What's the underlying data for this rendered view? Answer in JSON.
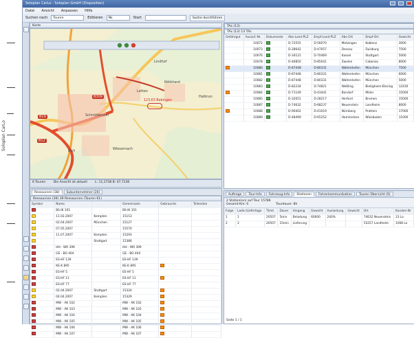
{
  "app": {
    "title": "Soloplan CarLo - Soloplan GmbH (Disposition)",
    "menu": [
      "Datei",
      "Ansicht",
      "Anpassen",
      "Hilfe"
    ],
    "window_buttons": [
      "_",
      "□",
      "✕"
    ]
  },
  "margin": {
    "vertical_text": "Soloplan CarLo"
  },
  "toolbar": {
    "search_label": "Suchen nach",
    "search_value": "Touren",
    "edit_label": "Editieren",
    "edit_value": "Nk",
    "start_label": "Start",
    "search_all_label": "Suche durchführen"
  },
  "map": {
    "panel_title": "Karte",
    "labels": [
      "Lindhof",
      "Letten",
      "Rötbhard",
      "Halbrun",
      "Schmittbrunn",
      "Eich",
      "Wiesernach"
    ],
    "roads": [
      "B19",
      "B309",
      "B12"
    ],
    "red_label": "123,63 Bebingen",
    "status_tours": "6 Touren",
    "status_text": "Die Ansicht ist aktuell",
    "status_coord": "L: 11,1738  B: 47,7136"
  },
  "tour_list": {
    "tab1": "Ressourcen (38)",
    "tab2": "Subunternehmer (20)",
    "subtitle": "Ressourcen (39)  39 Ressourcen (Touren 61)",
    "columns": [
      "Symbol",
      "Name",
      "Gemeinsam",
      "Gebrauchs",
      "Teilenden"
    ],
    "rows": [
      {
        "symbol": "truck",
        "name": "BS-IK 101",
        "place": "",
        "id": "BS-IK 101",
        "flag": false
      },
      {
        "symbol": "",
        "name": "11.02.2007",
        "place": "Kempten",
        "id": "15153",
        "flag": false
      },
      {
        "symbol": "",
        "name": "02.04.2007",
        "place": "München",
        "id": "15127",
        "flag": false
      },
      {
        "symbol": "",
        "name": "07.05.2007",
        "place": "",
        "id": "15570",
        "flag": false
      },
      {
        "symbol": "",
        "name": "11.07.2007",
        "place": "Kempten",
        "id": "15293",
        "flag": false
      },
      {
        "symbol": "",
        "name": "",
        "place": "Stuttgart",
        "id": "15386",
        "flag": false
      },
      {
        "symbol": "truck",
        "name": "HH - WR 399",
        "place": "",
        "id": "HH - WR 399",
        "flag": false
      },
      {
        "symbol": "truck",
        "name": "GE - BO 404",
        "place": "",
        "id": "GE - BO 404",
        "flag": false
      },
      {
        "symbol": "truck",
        "name": "ES-HF 139",
        "place": "",
        "id": "ES-HF 139",
        "flag": false
      },
      {
        "symbol": "truck",
        "name": "KE-K 895",
        "place": "",
        "id": "KE-K 895",
        "flag": true
      },
      {
        "symbol": "truck",
        "name": "ES-HF 5",
        "place": "",
        "id": "ES-HF 5",
        "flag": false
      },
      {
        "symbol": "truck",
        "name": "ES-HF 11",
        "place": "",
        "id": "ES-HF 11",
        "flag": true
      },
      {
        "symbol": "truck",
        "name": "ES-HF 77",
        "place": "",
        "id": "ES-HF 77",
        "flag": false
      },
      {
        "symbol": "",
        "name": "02.04.2007",
        "place": "Stuttgart",
        "id": "15324",
        "flag": true
      },
      {
        "symbol": "",
        "name": "04.04.2007",
        "place": "Kempten",
        "id": "15329",
        "flag": true
      },
      {
        "symbol": "truck",
        "name": "MW - AK 102",
        "place": "",
        "id": "MW - AK 102",
        "flag": true
      },
      {
        "symbol": "truck",
        "name": "MW - AK 103",
        "place": "",
        "id": "MW - AK 103",
        "flag": true
      },
      {
        "symbol": "truck",
        "name": "MW - AK 104",
        "place": "",
        "id": "MW - AK 104",
        "flag": true
      },
      {
        "symbol": "truck",
        "name": "MW - AK 105",
        "place": "",
        "id": "MW - AK 105",
        "flag": true
      },
      {
        "symbol": "truck",
        "name": "MW - AK 106",
        "place": "",
        "id": "MW - AK 106",
        "flag": true
      },
      {
        "symbol": "truck",
        "name": "MW - AK 107",
        "place": "",
        "id": "MW - AK 107",
        "flag": true
      }
    ]
  },
  "orders": {
    "panel_title": "TAs (13)",
    "subtitle": "TAs (13)  13 TAs",
    "columns": [
      "Gefahrgut",
      "Auszuf.-Nr.",
      "Dokumente",
      "Abs-Land-PLZ",
      "Empf-Land-PLZ",
      "Abs-Ort",
      "Empf-Ort",
      "Gewicht"
    ],
    "rows": [
      {
        "haz": false,
        "nr": "10072",
        "abs": "D-72555",
        "emp": "D-56070",
        "absort": "Metzingen",
        "empfort": "Koblenz",
        "gew": "3000"
      },
      {
        "haz": false,
        "nr": "10073",
        "abs": "D-28642",
        "emp": "D-47057",
        "absort": "Dessau",
        "empfort": "Duisburg",
        "gew": "7500"
      },
      {
        "haz": false,
        "nr": "10076",
        "abs": "D-34121",
        "emp": "D-70469",
        "absort": "Kassel",
        "empfort": "Stuttgart",
        "gew": "5000"
      },
      {
        "haz": false,
        "nr": "10078",
        "abs": "D-46850",
        "emp": "D-85041",
        "absort": "Zwolen",
        "empfort": "Cabenzo",
        "gew": "8000"
      },
      {
        "haz": true,
        "nr": "10080",
        "abs": "D-87448",
        "emp": "D-80331",
        "absort": "Waltenhofen",
        "empfort": "München",
        "gew": "7500"
      },
      {
        "haz": false,
        "nr": "10081",
        "abs": "D-87448",
        "emp": "D-80331",
        "absort": "Waltenhofen",
        "empfort": "München",
        "gew": "6000"
      },
      {
        "haz": false,
        "nr": "10082",
        "abs": "D-87448",
        "emp": "D-80331",
        "absort": "Waltenhofen",
        "empfort": "München",
        "gew": "5000"
      },
      {
        "haz": false,
        "nr": "10083",
        "abs": "D-82234",
        "emp": "D-74821",
        "absort": "Weßling",
        "empfort": "Bietigheim-Bissing",
        "gew": "12430"
      },
      {
        "haz": true,
        "nr": "10084",
        "abs": "D-71149",
        "emp": "D-43441",
        "absort": "Bondorf",
        "empfort": "Mider",
        "gew": "15000"
      },
      {
        "haz": false,
        "nr": "10085",
        "abs": "D-32051",
        "emp": "D-28217",
        "absort": "Herford",
        "empfort": "Bremen",
        "gew": "15000"
      },
      {
        "haz": false,
        "nr": "10087",
        "abs": "D-74632",
        "emp": "D-68237",
        "absort": "Neuenstein",
        "empfort": "Landheim",
        "gew": "8000"
      },
      {
        "haz": true,
        "nr": "10088",
        "abs": "D-90402",
        "emp": "D-41019",
        "absort": "Nürnberg",
        "empfort": "Prattein",
        "gew": "17000"
      },
      {
        "haz": false,
        "nr": "10089",
        "abs": "D-48499",
        "emp": "D-65252",
        "absort": "Hammelsen",
        "empfort": "Wiesbaden",
        "gew": "11000"
      }
    ]
  },
  "detail": {
    "tabs": [
      "Auftrage",
      "Tour-Info",
      "Fahrzeug-Info",
      "Stationen",
      "Fahrerkommunikation",
      "Touren Übersicht (0)"
    ],
    "subtitle": "2 Station(en) auf Tour 15786",
    "subtitle2": "Gesamt-Km: 0",
    "subtitle3": "Tourdauer: 8h",
    "columns": [
      "Folge",
      "Lade-/Liefertage",
      "Tkmt",
      "Dauer",
      "Vorgang",
      "Gewicht",
      "Auslastung",
      "Gewicht",
      "Ort",
      "Kunden-Nr"
    ],
    "rows": [
      {
        "folge": "1",
        "tage": "1",
        "tkmt": "20507",
        "dauer": "5min",
        "vorgang": "Beladung",
        "gew": "60000",
        "aus": "240%",
        "ort": "74632 Neuenstein",
        "kn": "23 Lo"
      },
      {
        "folge": "2",
        "tage": "2",
        "tkmt": "20507",
        "dauer": "15min",
        "vorgang": "Lieferung",
        "gew": "",
        "aus": "",
        "ort": "55257 Landheim",
        "kn": "1008 Lo"
      }
    ],
    "footer": "Seite 1 / 1"
  }
}
